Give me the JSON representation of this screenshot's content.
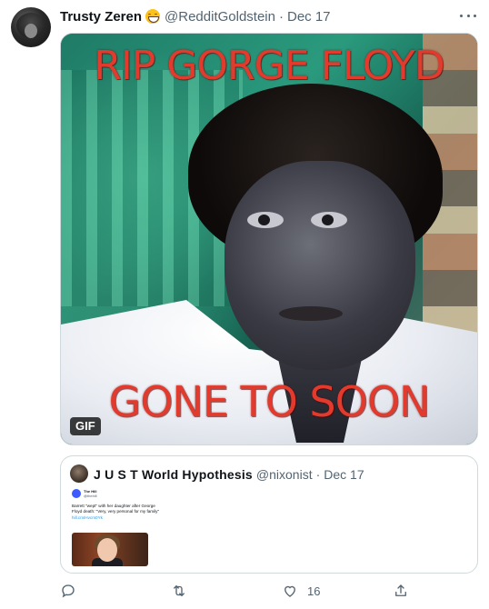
{
  "tweet": {
    "display_name": "Trusty Zeren",
    "emoji_icon": "grinning-face-icon",
    "handle": "@RedditGoldstein",
    "separator": "·",
    "date": "Dec 17"
  },
  "media": {
    "caption_top": "RIP GORGE FLOYD",
    "caption_bottom": "GONE TO SOON",
    "badge": "GIF",
    "caption_color": "#e23b2e"
  },
  "quote": {
    "display_name": "J U S T World Hypothesis",
    "handle": "@nixonist",
    "separator": "·",
    "date": "Dec 17",
    "embedded": {
      "name": "The Hill",
      "handle": "@thehill",
      "text": "Barrett \"wept\" with her daughter after George Floyd death: \"Very, very personal for my family\" ",
      "tag_text": "hill.cm/Hvcm0Yk"
    }
  },
  "actions": {
    "reply_icon": "reply-icon",
    "retweet_icon": "retweet-icon",
    "like_icon": "heart-icon",
    "like_count": "16",
    "share_icon": "share-icon"
  },
  "colors": {
    "text_primary": "#0f1419",
    "text_secondary": "#536471",
    "border": "#cfd9de",
    "link": "#1d9bf0"
  }
}
